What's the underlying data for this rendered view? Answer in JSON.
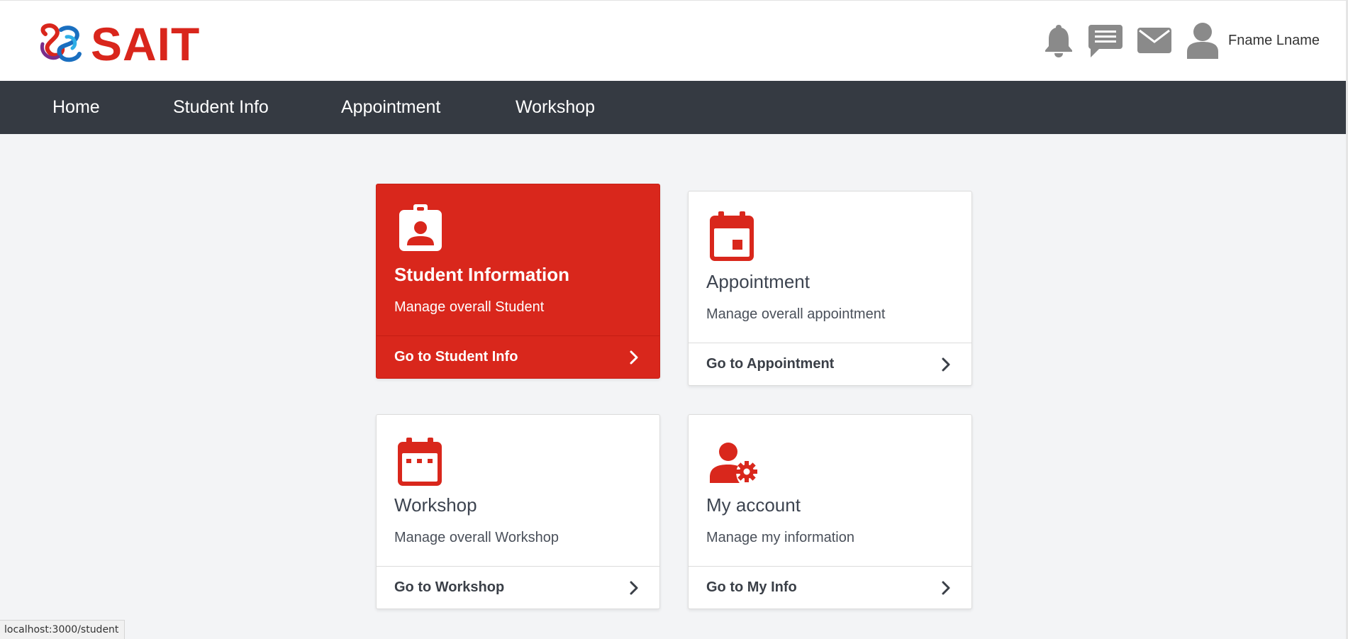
{
  "brand": {
    "logo_text": "SAIT",
    "colors": {
      "primary_red": "#d9271c",
      "nav_bg": "#353a42",
      "page_bg": "#f3f4f6"
    }
  },
  "header": {
    "icons": [
      "bell-icon",
      "chat-icon",
      "mail-icon",
      "user-avatar-icon"
    ],
    "user_name": "Fname Lname"
  },
  "nav": {
    "items": [
      {
        "label": "Home"
      },
      {
        "label": "Student Info"
      },
      {
        "label": "Appointment"
      },
      {
        "label": "Workshop"
      }
    ]
  },
  "cards": [
    {
      "icon": "id-badge-icon",
      "title": "Student Information",
      "description": "Manage overall Student",
      "link": "Go to Student Info",
      "active": true
    },
    {
      "icon": "calendar-day-icon",
      "title": "Appointment",
      "description": "Manage overall appointment",
      "link": "Go to Appointment",
      "active": false
    },
    {
      "icon": "calendar-week-icon",
      "title": "Workshop",
      "description": "Manage overall Workshop",
      "link": "Go to Workshop",
      "active": false
    },
    {
      "icon": "user-gear-icon",
      "title": "My account",
      "description": "Manage my information",
      "link": "Go to My Info",
      "active": false
    }
  ],
  "status_bar": {
    "url": "localhost:3000/student"
  }
}
